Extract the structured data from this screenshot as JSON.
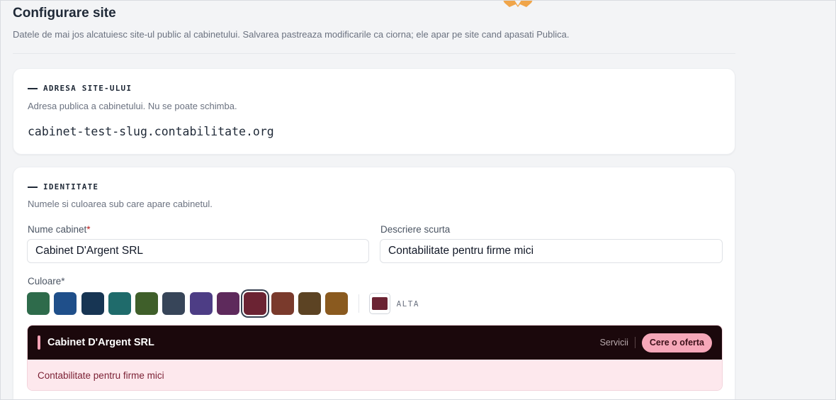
{
  "page": {
    "title": "Configurare site",
    "subtitle": "Datele de mai jos alcatuiesc site-ul public al cabinetului. Salvarea pastreaza modificarile ca ciorna; ele apar pe site cand apasati Publica."
  },
  "address_section": {
    "heading": "ADRESA SITE-ULUI",
    "description": "Adresa publica a cabinetului. Nu se poate schimba.",
    "address": "cabinet-test-slug.contabilitate.org"
  },
  "identity_section": {
    "heading": "IDENTITATE",
    "description": "Numele si culoarea sub care apare cabinetul.",
    "name_label": "Nume cabinet",
    "name_required_mark": "*",
    "name_value": "Cabinet D'Argent SRL",
    "desc_label": "Descriere scurta",
    "desc_value": "Contabilitate pentru firme mici",
    "color_label": "Culoare*",
    "swatches": [
      "#2e6b4b",
      "#1f4f8a",
      "#173553",
      "#1f6b6b",
      "#3f5f2a",
      "#374559",
      "#4d3d85",
      "#5e2a5c",
      "#6b2333",
      "#7a3a2c",
      "#5c4323",
      "#8a5a1f"
    ],
    "selected_swatch": "#6b2333",
    "custom_color": "#6b2333",
    "custom_label": "ALTA"
  },
  "preview": {
    "name": "Cabinet D'Argent SRL",
    "nav_link": "Servicii",
    "cta": "Cere o oferta",
    "tagline": "Contabilitate pentru firme mici",
    "colors": {
      "bar_bg": "#1b080c",
      "accent": "#f4a3b6",
      "cta_bg": "#f6a7b9",
      "band_bg": "#fde8ed",
      "band_text": "#7a1f33"
    }
  }
}
